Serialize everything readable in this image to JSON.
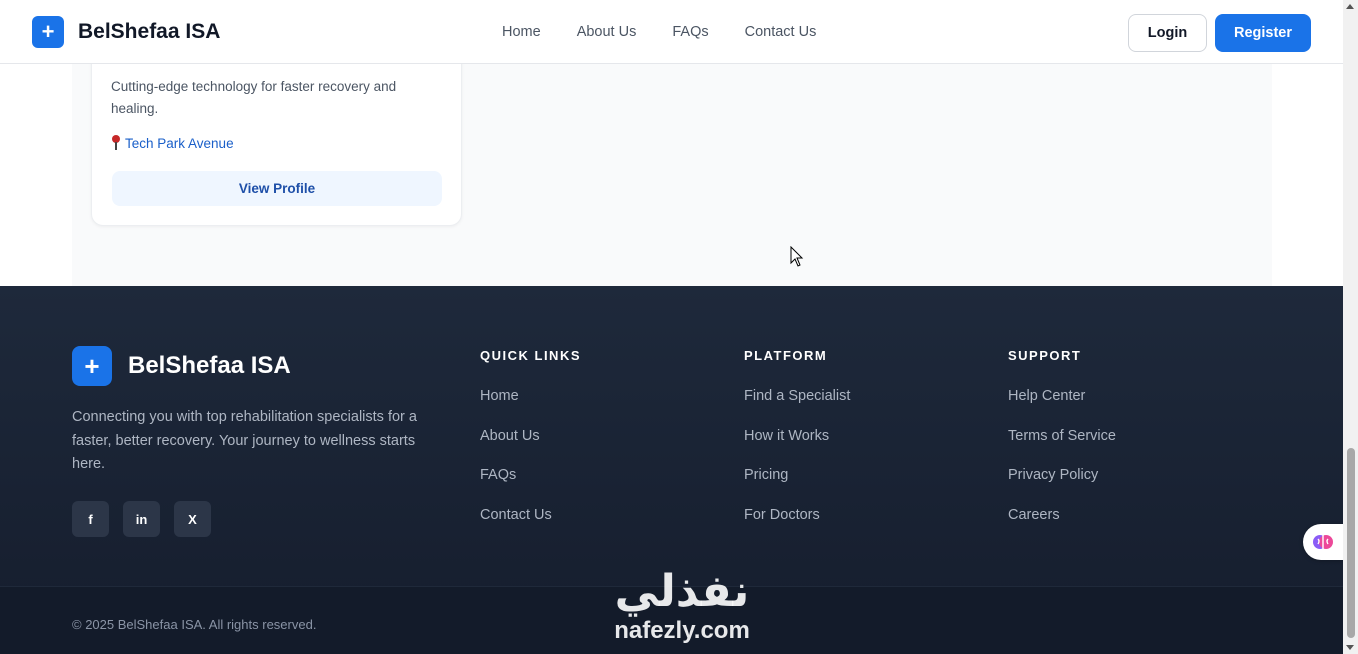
{
  "header": {
    "brand_icon": "+",
    "brand_name": "BelShefaa ISA",
    "nav": [
      "Home",
      "About Us",
      "FAQs",
      "Contact Us"
    ],
    "login": "Login",
    "register": "Register"
  },
  "card": {
    "description": "Cutting-edge technology for faster recovery and healing.",
    "location_icon": "pin-icon",
    "location": "Tech Park Avenue",
    "view_profile": "View Profile"
  },
  "footer": {
    "brand_icon": "+",
    "brand_name": "BelShefaa ISA",
    "description": "Connecting you with top rehabilitation specialists for a faster, better recovery. Your journey to wellness starts here.",
    "socials": [
      "f",
      "in",
      "X"
    ],
    "columns": [
      {
        "title": "QUICK LINKS",
        "links": [
          "Home",
          "About Us",
          "FAQs",
          "Contact Us"
        ]
      },
      {
        "title": "PLATFORM",
        "links": [
          "Find a Specialist",
          "How it Works",
          "Pricing",
          "For Doctors"
        ]
      },
      {
        "title": "SUPPORT",
        "links": [
          "Help Center",
          "Terms of Service",
          "Privacy Policy",
          "Careers"
        ]
      }
    ],
    "copyright": "© 2025 BelShefaa ISA. All rights reserved."
  },
  "watermark": {
    "arabic": "نفذلي",
    "latin": "nafezly.com"
  },
  "colors": {
    "primary": "#1a73e8",
    "footer_bg": "#1e293b",
    "link": "#1a5fc9"
  }
}
